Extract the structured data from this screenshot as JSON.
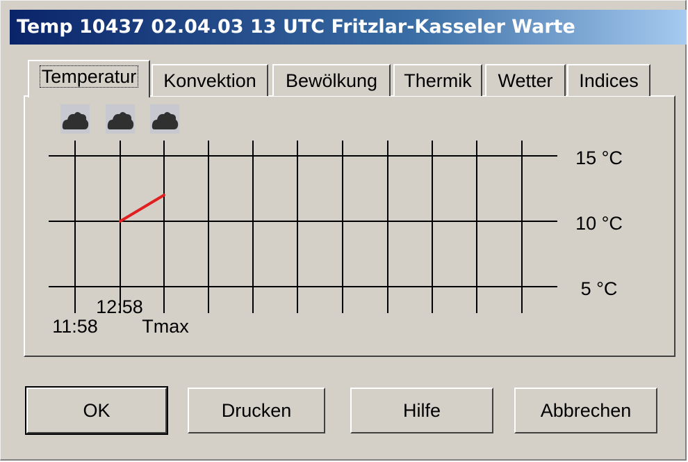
{
  "window": {
    "title": "Temp 10437 02.04.03 13 UTC Fritzlar-Kasseler Warte"
  },
  "tabs": [
    {
      "label": "Temperatur",
      "active": true
    },
    {
      "label": "Konvektion",
      "active": false
    },
    {
      "label": "Bewölkung",
      "active": false
    },
    {
      "label": "Thermik",
      "active": false
    },
    {
      "label": "Wetter",
      "active": false
    },
    {
      "label": "Indices",
      "active": false
    }
  ],
  "cloud_icons": [
    "cloud-icon",
    "cloud-icon",
    "cloud-icon"
  ],
  "chart_data": {
    "type": "line",
    "title": "",
    "y_unit": "°C",
    "ylim": [
      5,
      15
    ],
    "ytick_labels": [
      "15 °C",
      "10 °C",
      "5 °C"
    ],
    "ytick_values": [
      15,
      10,
      5
    ],
    "x_labels": [
      "11:58",
      "12:58",
      "Tmax"
    ],
    "grid": true,
    "series": [
      {
        "color": "#e02020",
        "x": [
          "12:58",
          "Tmax"
        ],
        "values": [
          10,
          12
        ]
      }
    ]
  },
  "buttons": {
    "ok": "OK",
    "print": "Drucken",
    "help": "Hilfe",
    "cancel": "Abbrechen"
  }
}
